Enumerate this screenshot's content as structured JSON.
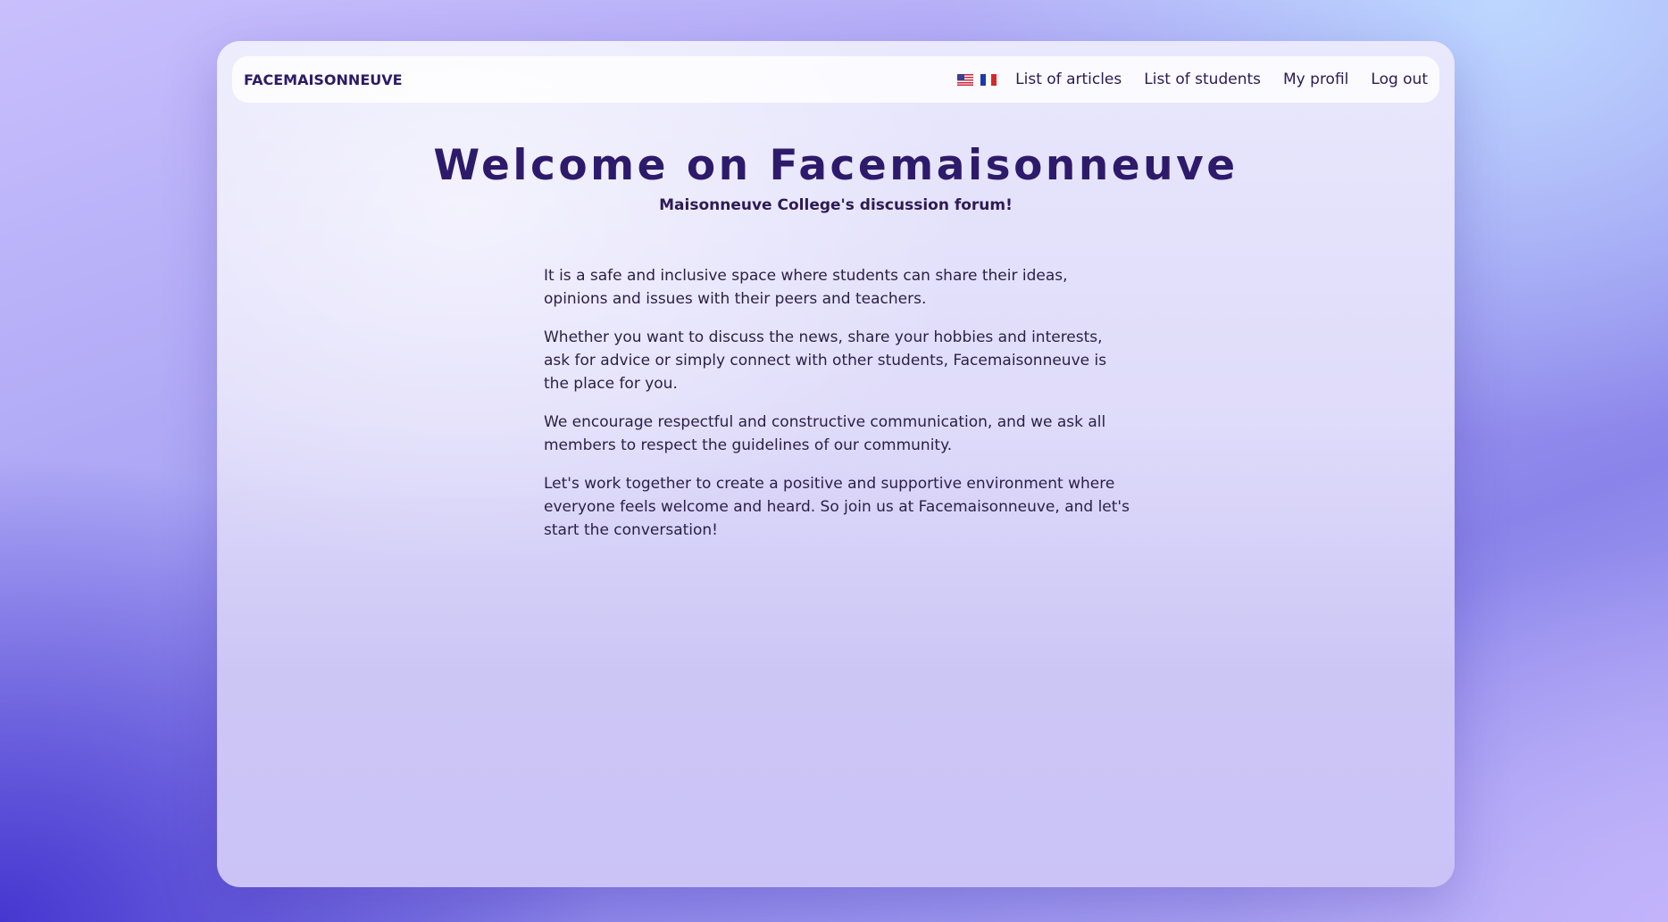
{
  "navbar": {
    "brand": "FACEMAISONNEUVE",
    "languages": [
      {
        "name": "english",
        "icon": "us-flag-icon"
      },
      {
        "name": "french",
        "icon": "fr-flag-icon"
      }
    ],
    "links": [
      {
        "label": "List of articles"
      },
      {
        "label": "List of students"
      },
      {
        "label": "My profil"
      },
      {
        "label": "Log out"
      }
    ]
  },
  "hero": {
    "title": "Welcome on Facemaisonneuve",
    "subtitle": "Maisonneuve College's discussion forum!"
  },
  "content": {
    "paragraphs": [
      "It is a safe and inclusive space where students can share their ideas, opinions and issues with their peers and teachers.",
      "Whether you want to discuss the news, share your hobbies and interests, ask for advice or simply connect with other students, Facemaisonneuve is the place for you.",
      "We encourage respectful and constructive communication, and we ask all members to respect the guidelines of our community.",
      "Let's work together to create a positive and supportive environment where everyone feels welcome and heard. So join us at Facemaisonneuve, and let's start the conversation!"
    ]
  },
  "colors": {
    "brand": "#2b1b66",
    "title": "#2e1a6b",
    "text": "#2a1f45"
  }
}
